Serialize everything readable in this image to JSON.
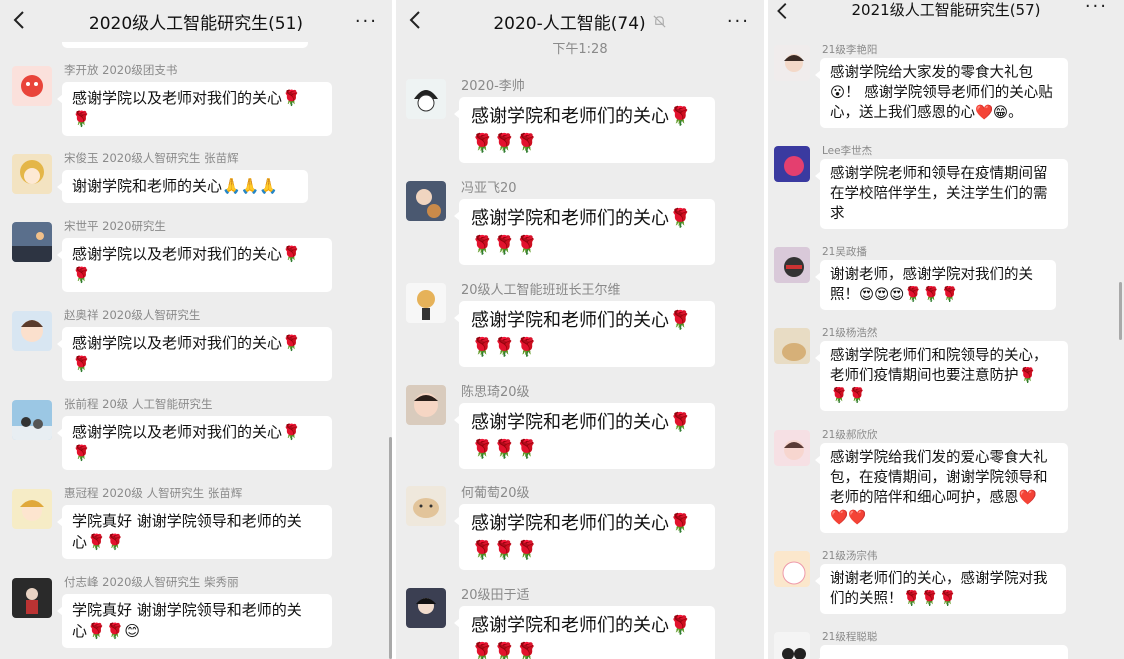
{
  "colors": {
    "bg": "#ededed",
    "bubble": "#ffffff",
    "name": "#8a8a8a",
    "rose": "#d42a2a",
    "heart": "#e8455a"
  },
  "icons": {
    "back": "chevron-left-icon",
    "more": "more-dots-icon",
    "mute": "bell-off-icon"
  },
  "left": {
    "title": "2020级人工智能研究生(51)",
    "more": "···",
    "messages": [
      {
        "sender": "李开放 2020级团支书",
        "text": "感谢学院以及老师对我们的关心🌹",
        "tail": "🌹"
      },
      {
        "sender": "宋俊玉 2020级人智研究生 张苗辉",
        "text": "谢谢学院和老师的关心🙏🙏🙏",
        "tail": ""
      },
      {
        "sender": "宋世平 2020研究生",
        "text": "感谢学院以及老师对我们的关心🌹",
        "tail": "🌹"
      },
      {
        "sender": "赵奥祥 2020级人智研究生",
        "text": "感谢学院以及老师对我们的关心🌹",
        "tail": "🌹"
      },
      {
        "sender": "张前程 20级 人工智能研究生",
        "text": "感谢学院以及老师对我们的关心🌹",
        "tail": "🌹"
      },
      {
        "sender": "惠冠程 2020级 人智研究生 张苗辉",
        "text": "学院真好 谢谢学院领导和老师的关",
        "tail": "心🌹🌹"
      },
      {
        "sender": "付志峰 2020级人智研究生 柴秀丽",
        "text": "学院真好 谢谢学院领导和老师的关",
        "tail": "心🌹🌹😊"
      }
    ]
  },
  "middle": {
    "title": "2020-人工智能(74)",
    "more": "···",
    "time": "下午1:28",
    "messages": [
      {
        "sender": "2020-李帅",
        "text": "感谢学院和老师们的关心🌹",
        "tail": "🌹🌹🌹"
      },
      {
        "sender": "冯亚飞20",
        "text": "感谢学院和老师们的关心🌹",
        "tail": "🌹🌹🌹"
      },
      {
        "sender": "20级人工智能班班长王尔维",
        "text": "感谢学院和老师们的关心🌹",
        "tail": "🌹🌹🌹"
      },
      {
        "sender": "陈思琦20级",
        "text": "感谢学院和老师们的关心🌹",
        "tail": "🌹🌹🌹"
      },
      {
        "sender": "何葡萄20级",
        "text": "感谢学院和老师们的关心🌹",
        "tail": "🌹🌹🌹"
      },
      {
        "sender": "20级田于适",
        "text": "感谢学院和老师们的关心🌹",
        "tail": "🌹🌹🌹"
      }
    ]
  },
  "right": {
    "title": "2021级人工智能研究生(57)",
    "more": "···",
    "messages": [
      {
        "sender": "21级李艳阳",
        "lines": [
          "感谢学院给大家发的零食大礼包",
          "😮！ 感谢学院领导老师们的关心贴",
          "心，送上我们感恩的心❤️😁。"
        ]
      },
      {
        "sender": "Lee李世杰",
        "lines": [
          "感谢学院老师和领导在疫情期间留",
          "在学校陪伴学生，关注学生们的需",
          "求"
        ]
      },
      {
        "sender": "21吴政播",
        "lines": [
          "谢谢老师，感谢学院对我们的关",
          "照！😍😍😍🌹🌹🌹"
        ]
      },
      {
        "sender": "21级杨浩然",
        "lines": [
          "感谢学院老师们和院领导的关心，",
          "老师们疫情期间也要注意防护🌹",
          "🌹🌹"
        ]
      },
      {
        "sender": "21级郝欣欣",
        "lines": [
          "感谢学院给我们发的爱心零食大礼",
          "包，在疫情期间，谢谢学院领导和",
          "老师的陪伴和细心呵护，感恩❤️",
          "❤️❤️"
        ]
      },
      {
        "sender": "21级汤宗伟",
        "lines": [
          "谢谢老师们的关心，感谢学院对我",
          "们的关照！🌹🌹🌹"
        ]
      },
      {
        "sender": "21级程聪聪",
        "lines": []
      }
    ]
  }
}
